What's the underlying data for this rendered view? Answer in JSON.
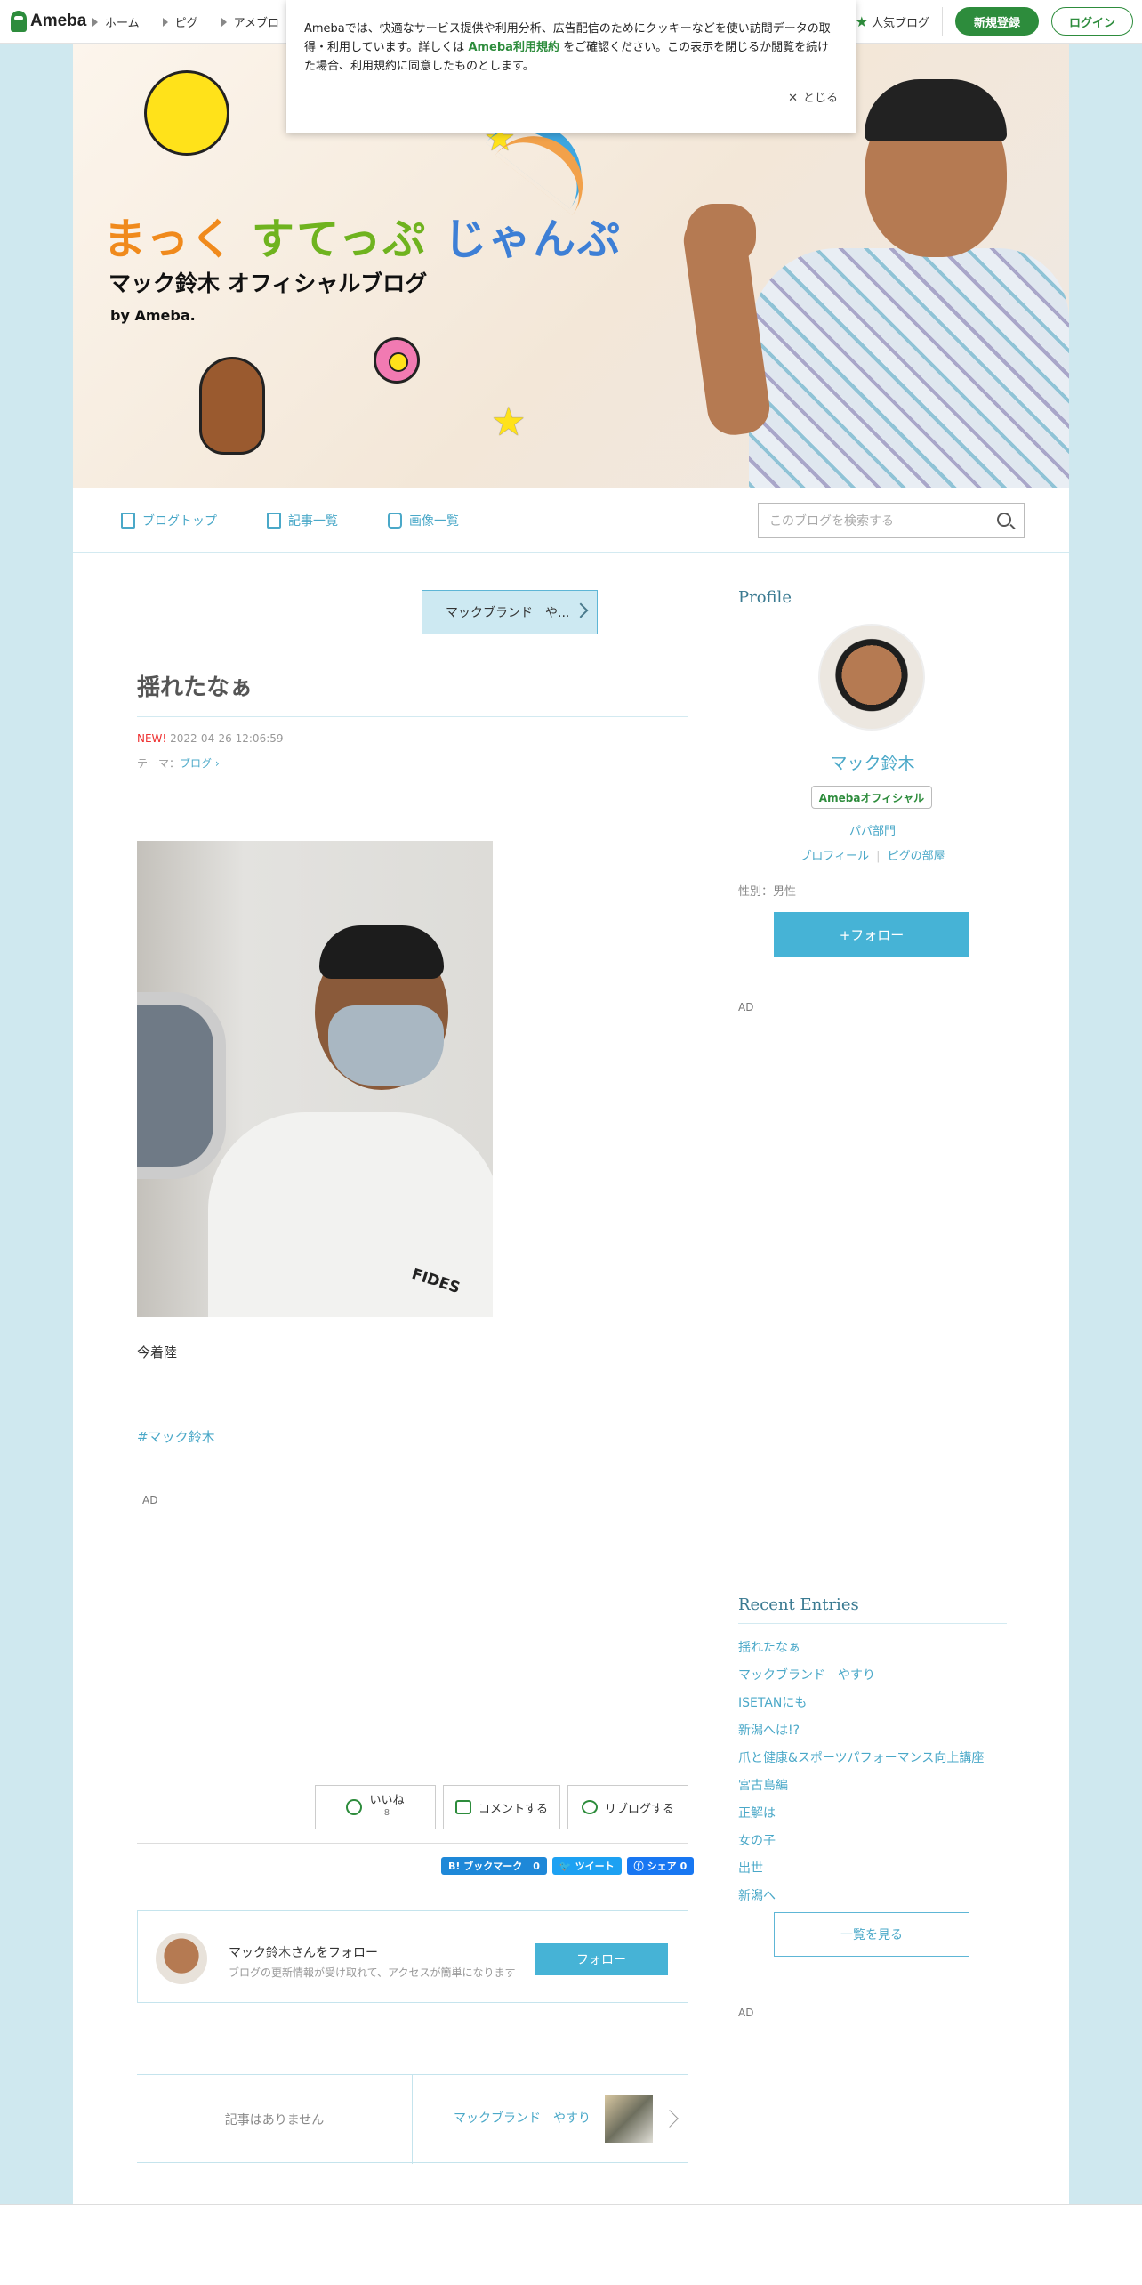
{
  "topbar": {
    "logo": "Ameba",
    "nav": [
      "ホーム",
      "ピグ",
      "アメブロ"
    ],
    "popular": "人気ブログ",
    "signup": "新規登録",
    "login": "ログイン"
  },
  "cookie": {
    "text_before": "Amebaでは、快適なサービス提供や利用分析、広告配信のためにクッキーなどを使い訪問データの取得・利用しています。詳しくは",
    "link": "Ameba利用規約",
    "text_after": "をご確認ください。この表示を閉じるか閲覧を続けた場合、利用規約に同意したものとします。",
    "close": "とじる"
  },
  "header": {
    "title_a": "まっく",
    "title_b": "すてっぷ",
    "title_c": "じゃんぷ",
    "subtitle": "マック鈴木  オフィシャルブログ",
    "by": "by Ameba."
  },
  "blognav": {
    "top": "ブログトップ",
    "list": "記事一覧",
    "images": "画像一覧",
    "search_placeholder": "このブログを検索する"
  },
  "article": {
    "theme_button": "マックブランド　や...",
    "title": "揺れたなぁ",
    "new_label": "NEW!",
    "date": "2022-04-26 12:06:59",
    "theme_label": "テーマ：",
    "theme": "ブログ",
    "body": "今着陸",
    "hashtag": "#マック鈴木",
    "ad": "AD",
    "shirt_text": "FIDES",
    "like": "いいね",
    "like_count": "8",
    "comment": "コメントする",
    "reblog": "リブログする",
    "share_hatena": "B! ブックマーク",
    "share_hatena_count": "0",
    "share_tweet": "ツイート",
    "share_fb": "シェア",
    "share_fb_count": "0",
    "follow_name": "マック鈴木さんをフォロー",
    "follow_desc": "ブログの更新情報が受け取れて、アクセスが簡単になります",
    "follow_button": "フォロー",
    "pager_none": "記事はありません",
    "pager_next": "マックブランド　やすり"
  },
  "sidebar": {
    "profile_heading": "Profile",
    "name": "マック鈴木",
    "badge": "Amebaオフィシャル",
    "category": "パパ部門",
    "link_profile": "プロフィール",
    "link_pig": "ピグの部屋",
    "gender": "性別：男性",
    "follow": "+フォロー",
    "ad": "AD",
    "recent_heading": "Recent Entries",
    "recent": [
      "揺れたなぁ",
      "マックブランド　やすり",
      "ISETANにも",
      "新潟へは!?",
      "爪と健康&スポーツパフォーマンス向上講座",
      "宮古島編",
      "正解は",
      "女の子",
      "出世",
      "新潟へ"
    ],
    "see_all": "一覧を見る",
    "ad2": "AD"
  }
}
